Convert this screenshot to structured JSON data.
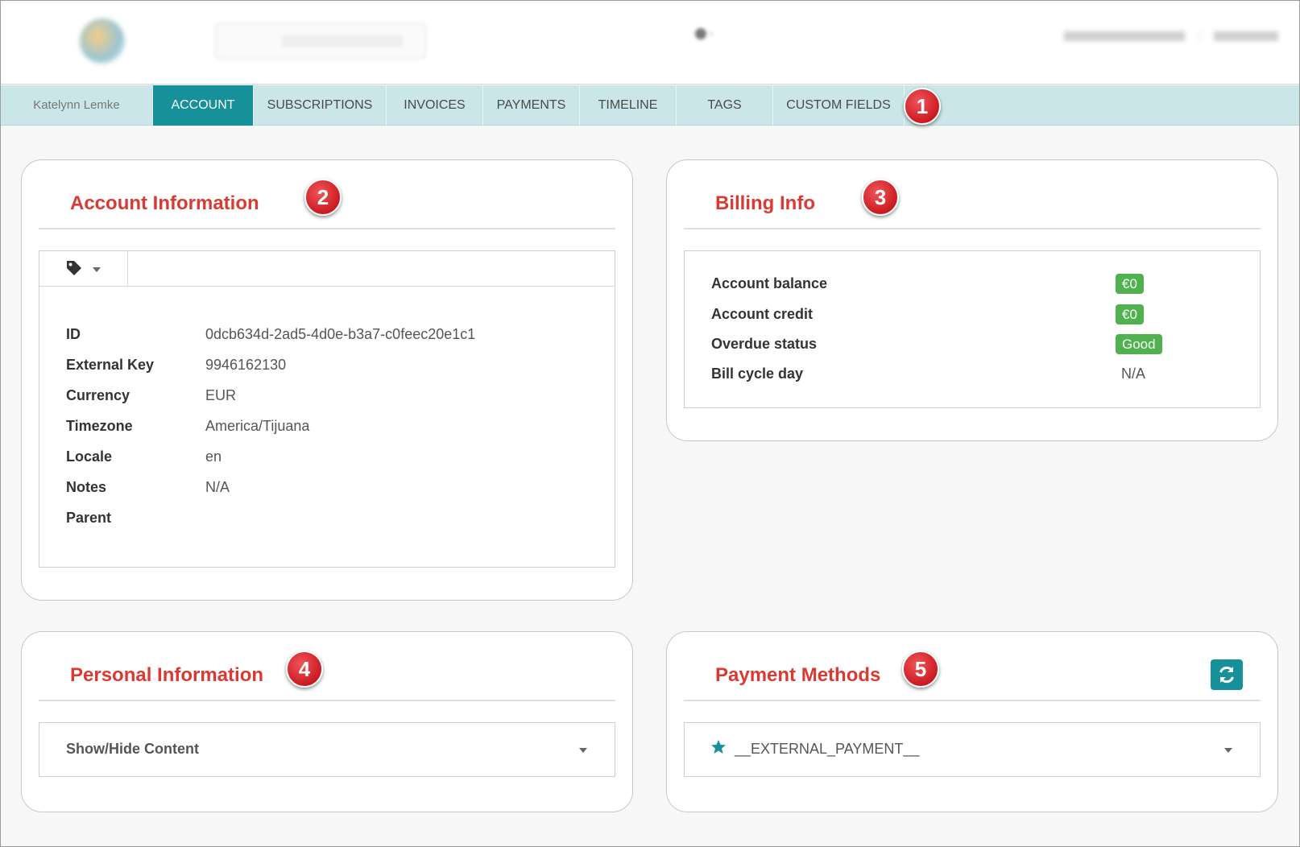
{
  "tabs": [
    {
      "label": "Katelynn Lemke",
      "kind": "name"
    },
    {
      "label": "ACCOUNT",
      "kind": "active"
    },
    {
      "label": "SUBSCRIPTIONS",
      "kind": "normal"
    },
    {
      "label": "INVOICES",
      "kind": "normal"
    },
    {
      "label": "PAYMENTS",
      "kind": "normal"
    },
    {
      "label": "TIMELINE",
      "kind": "normal"
    },
    {
      "label": "TAGS",
      "kind": "normal"
    },
    {
      "label": "CUSTOM FIELDS",
      "kind": "normal"
    }
  ],
  "badges": [
    "1",
    "2",
    "3",
    "4",
    "5"
  ],
  "account_info": {
    "title": "Account Information",
    "fields": [
      {
        "label": "ID",
        "value": "0dcb634d-2ad5-4d0e-b3a7-c0feec20e1c1"
      },
      {
        "label": "External Key",
        "value": "9946162130"
      },
      {
        "label": "Currency",
        "value": "EUR"
      },
      {
        "label": "Timezone",
        "value": "America/Tijuana"
      },
      {
        "label": "Locale",
        "value": "en"
      },
      {
        "label": "Notes",
        "value": "N/A"
      },
      {
        "label": "Parent",
        "value": ""
      }
    ]
  },
  "billing_info": {
    "title": "Billing Info",
    "rows": [
      {
        "label": "Account balance",
        "value": "€0",
        "style": "pill"
      },
      {
        "label": "Account credit",
        "value": "€0",
        "style": "pill"
      },
      {
        "label": "Overdue status",
        "value": "Good",
        "style": "pill"
      },
      {
        "label": "Bill cycle day",
        "value": "N/A",
        "style": "plain"
      }
    ]
  },
  "personal_info": {
    "title": "Personal Information",
    "toggle_label": "Show/Hide Content"
  },
  "payment_methods": {
    "title": "Payment Methods",
    "default_method": "__EXTERNAL_PAYMENT__"
  },
  "colors": {
    "accent": "#16919a",
    "title_red": "#d93a32",
    "pill_green": "#4fb24f",
    "tabbar_bg": "#cbe6e8"
  },
  "icons": {
    "tag": "tag-icon",
    "refresh": "refresh-icon",
    "star": "star-icon",
    "caret": "chevron-down-icon"
  }
}
